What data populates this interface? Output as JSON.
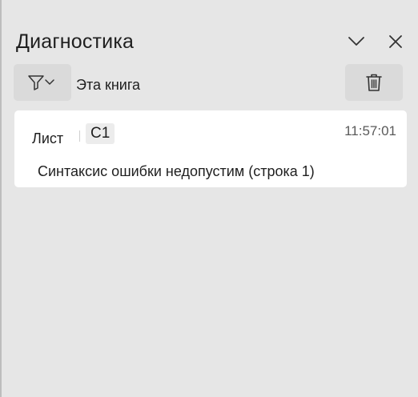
{
  "pane": {
    "title": "Диагностика",
    "collapse_icon": "chevron-down-icon",
    "close_icon": "close-icon"
  },
  "toolbar": {
    "filter_icon": "filter-icon",
    "scope_label": "Эта книга",
    "delete_icon": "trash-icon"
  },
  "entries": [
    {
      "sheet": "Лист",
      "cell": "C1",
      "time": "11:57:01",
      "message": "Синтаксис ошибки недопустим (строка 1)"
    }
  ],
  "colors": {
    "pane_background": "#e6e6e6",
    "button_background": "#dadada",
    "card_background": "#ffffff",
    "badge_background": "#ececec"
  }
}
